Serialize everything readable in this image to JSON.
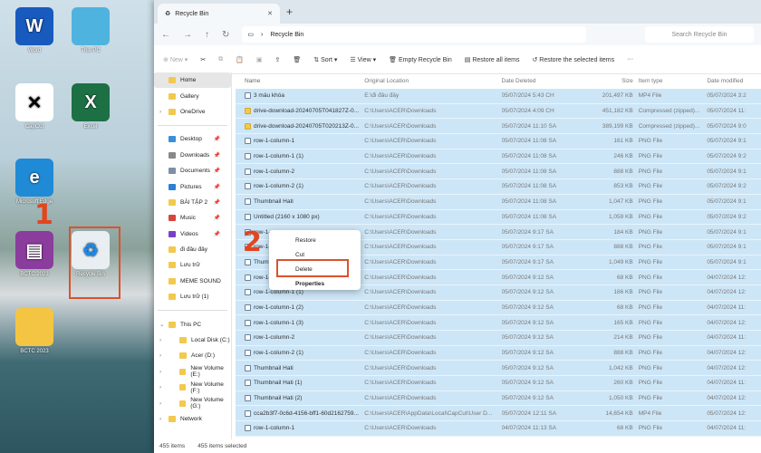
{
  "desktop": {
    "icons": [
      {
        "label": "Word",
        "glyph": "W",
        "color": "#185abd"
      },
      {
        "label": "This PC",
        "glyph": "",
        "color": "#4fb3e0"
      },
      {
        "label": "CapCut",
        "glyph": "✕",
        "color": "#ffffff"
      },
      {
        "label": "Excel",
        "glyph": "X",
        "color": "#1d7044"
      },
      {
        "label": "Microsoft Edge",
        "glyph": "e",
        "color": "#1f8ad6"
      },
      {
        "label": "BCTC 2023",
        "glyph": "▤",
        "color": "#8a3d9c"
      },
      {
        "label": "Recycle Bin",
        "glyph": "♻",
        "color": "#e8eef2"
      },
      {
        "label": "BCTC 2023",
        "glyph": "",
        "color": "#f4c542"
      }
    ],
    "step1": "1",
    "step2": "2",
    "accent": "#e0461f"
  },
  "window": {
    "tab_title": "Recycle Bin",
    "breadcrumb": "Recycle Bin",
    "search_placeholder": "Search Recycle Bin",
    "toolbar": {
      "new": "New",
      "sort": "Sort",
      "view": "View",
      "empty": "Empty Recycle Bin",
      "restore_all": "Restore all items",
      "restore_selected": "Restore the selected items",
      "more": "···"
    }
  },
  "sidebar": {
    "top": [
      "Home",
      "Gallery",
      "OneDrive"
    ],
    "quick": [
      "Desktop",
      "Downloads",
      "Documents",
      "Pictures",
      "BÀI TẬP 2",
      "Music",
      "Videos",
      "đi đâu đây",
      "Lưu trữ",
      "MEME SOUND",
      "Lưu trữ (1)"
    ],
    "pc": [
      "This PC",
      "Local Disk (C:)",
      "Acer (D:)",
      "New Volume (E:)",
      "New Volume (F:)",
      "New Volume (G:)",
      "Network"
    ]
  },
  "columns": [
    "Name",
    "Original Location",
    "Date Deleted",
    "Size",
    "Item type",
    "Date modified"
  ],
  "rows": [
    [
      "3 mẫu khóa",
      "E:\\đi đâu đây",
      "05/07/2024 5:43 CH",
      "201,497 KB",
      "MP4 File",
      "05/07/2024 3:2"
    ],
    [
      "drive-download-20240705T041827Z-0...",
      "C:\\Users\\ACER\\Downloads",
      "05/07/2024 4:09 CH",
      "451,182 KB",
      "Compressed (zipped)...",
      "05/07/2024 11:"
    ],
    [
      "drive-download-20240705T020213Z-0...",
      "C:\\Users\\ACER\\Downloads",
      "05/07/2024 11:10 SA",
      "389,199 KB",
      "Compressed (zipped)...",
      "05/07/2024 9:0"
    ],
    [
      "row-1-column-1",
      "C:\\Users\\ACER\\Downloads",
      "05/07/2024 11:08 SA",
      "161 KB",
      "PNG File",
      "05/07/2024 9:1"
    ],
    [
      "row-1-column-1 (1)",
      "C:\\Users\\ACER\\Downloads",
      "05/07/2024 11:08 SA",
      "246 KB",
      "PNG File",
      "05/07/2024 9:2"
    ],
    [
      "row-1-column-2",
      "C:\\Users\\ACER\\Downloads",
      "05/07/2024 11:08 SA",
      "888 KB",
      "PNG File",
      "05/07/2024 9:1"
    ],
    [
      "row-1-column-2 (1)",
      "C:\\Users\\ACER\\Downloads",
      "05/07/2024 11:08 SA",
      "853 KB",
      "PNG File",
      "05/07/2024 9:2"
    ],
    [
      "Thumbnail Hati",
      "C:\\Users\\ACER\\Downloads",
      "05/07/2024 11:08 SA",
      "1,047 KB",
      "PNG File",
      "05/07/2024 9:1"
    ],
    [
      "Untitled (2160 x 1080 px)",
      "C:\\Users\\ACER\\Downloads",
      "05/07/2024 11:08 SA",
      "1,059 KB",
      "PNG File",
      "05/07/2024 9:2"
    ],
    [
      "row-1-c",
      "C:\\Users\\ACER\\Downloads",
      "05/07/2024 9:17 SA",
      "184 KB",
      "PNG File",
      "05/07/2024 9:1"
    ],
    [
      "row-1-c",
      "C:\\Users\\ACER\\Downloads",
      "05/07/2024 9:17 SA",
      "888 KB",
      "PNG File",
      "05/07/2024 9:1"
    ],
    [
      "Thumbn",
      "C:\\Users\\ACER\\Downloads",
      "05/07/2024 9:17 SA",
      "1,049 KB",
      "PNG File",
      "05/07/2024 9:1"
    ],
    [
      "row-1-c",
      "C:\\Users\\ACER\\Downloads",
      "05/07/2024 9:12 SA",
      "68 KB",
      "PNG File",
      "04/07/2024 12:"
    ],
    [
      "row-1-column-1 (1)",
      "C:\\Users\\ACER\\Downloads",
      "05/07/2024 9:12 SA",
      "186 KB",
      "PNG File",
      "04/07/2024 12:"
    ],
    [
      "row-1-column-1 (2)",
      "C:\\Users\\ACER\\Downloads",
      "05/07/2024 9:12 SA",
      "68 KB",
      "PNG File",
      "04/07/2024 11:"
    ],
    [
      "row-1-column-1 (3)",
      "C:\\Users\\ACER\\Downloads",
      "05/07/2024 9:12 SA",
      "165 KB",
      "PNG File",
      "04/07/2024 12:"
    ],
    [
      "row-1-column-2",
      "C:\\Users\\ACER\\Downloads",
      "05/07/2024 9:12 SA",
      "214 KB",
      "PNG File",
      "04/07/2024 11:"
    ],
    [
      "row-1-column-2 (1)",
      "C:\\Users\\ACER\\Downloads",
      "05/07/2024 9:12 SA",
      "888 KB",
      "PNG File",
      "04/07/2024 12:"
    ],
    [
      "Thumbnail Hati",
      "C:\\Users\\ACER\\Downloads",
      "05/07/2024 9:12 SA",
      "1,042 KB",
      "PNG File",
      "04/07/2024 12:"
    ],
    [
      "Thumbnail Hati (1)",
      "C:\\Users\\ACER\\Downloads",
      "05/07/2024 9:12 SA",
      "260 KB",
      "PNG File",
      "04/07/2024 11:"
    ],
    [
      "Thumbnail Hati (2)",
      "C:\\Users\\ACER\\Downloads",
      "05/07/2024 9:12 SA",
      "1,050 KB",
      "PNG File",
      "04/07/2024 12:"
    ],
    [
      "cca2b3f7-0c6d-4156-bff1-60d2162759...",
      "C:\\Users\\ACER\\AppData\\Local\\CapCut\\User D...",
      "05/07/2024 12:11 SA",
      "14,654 KB",
      "MP4 File",
      "05/07/2024 12:"
    ],
    [
      "row-1-column-1",
      "C:\\Users\\ACER\\Downloads",
      "04/07/2024 11:13 SA",
      "68 KB",
      "PNG File",
      "04/07/2024 11:"
    ]
  ],
  "context_menu": [
    "Restore",
    "Cut",
    "Delete",
    "Properties"
  ],
  "status": {
    "count": "455 items",
    "selected": "455 items selected"
  }
}
